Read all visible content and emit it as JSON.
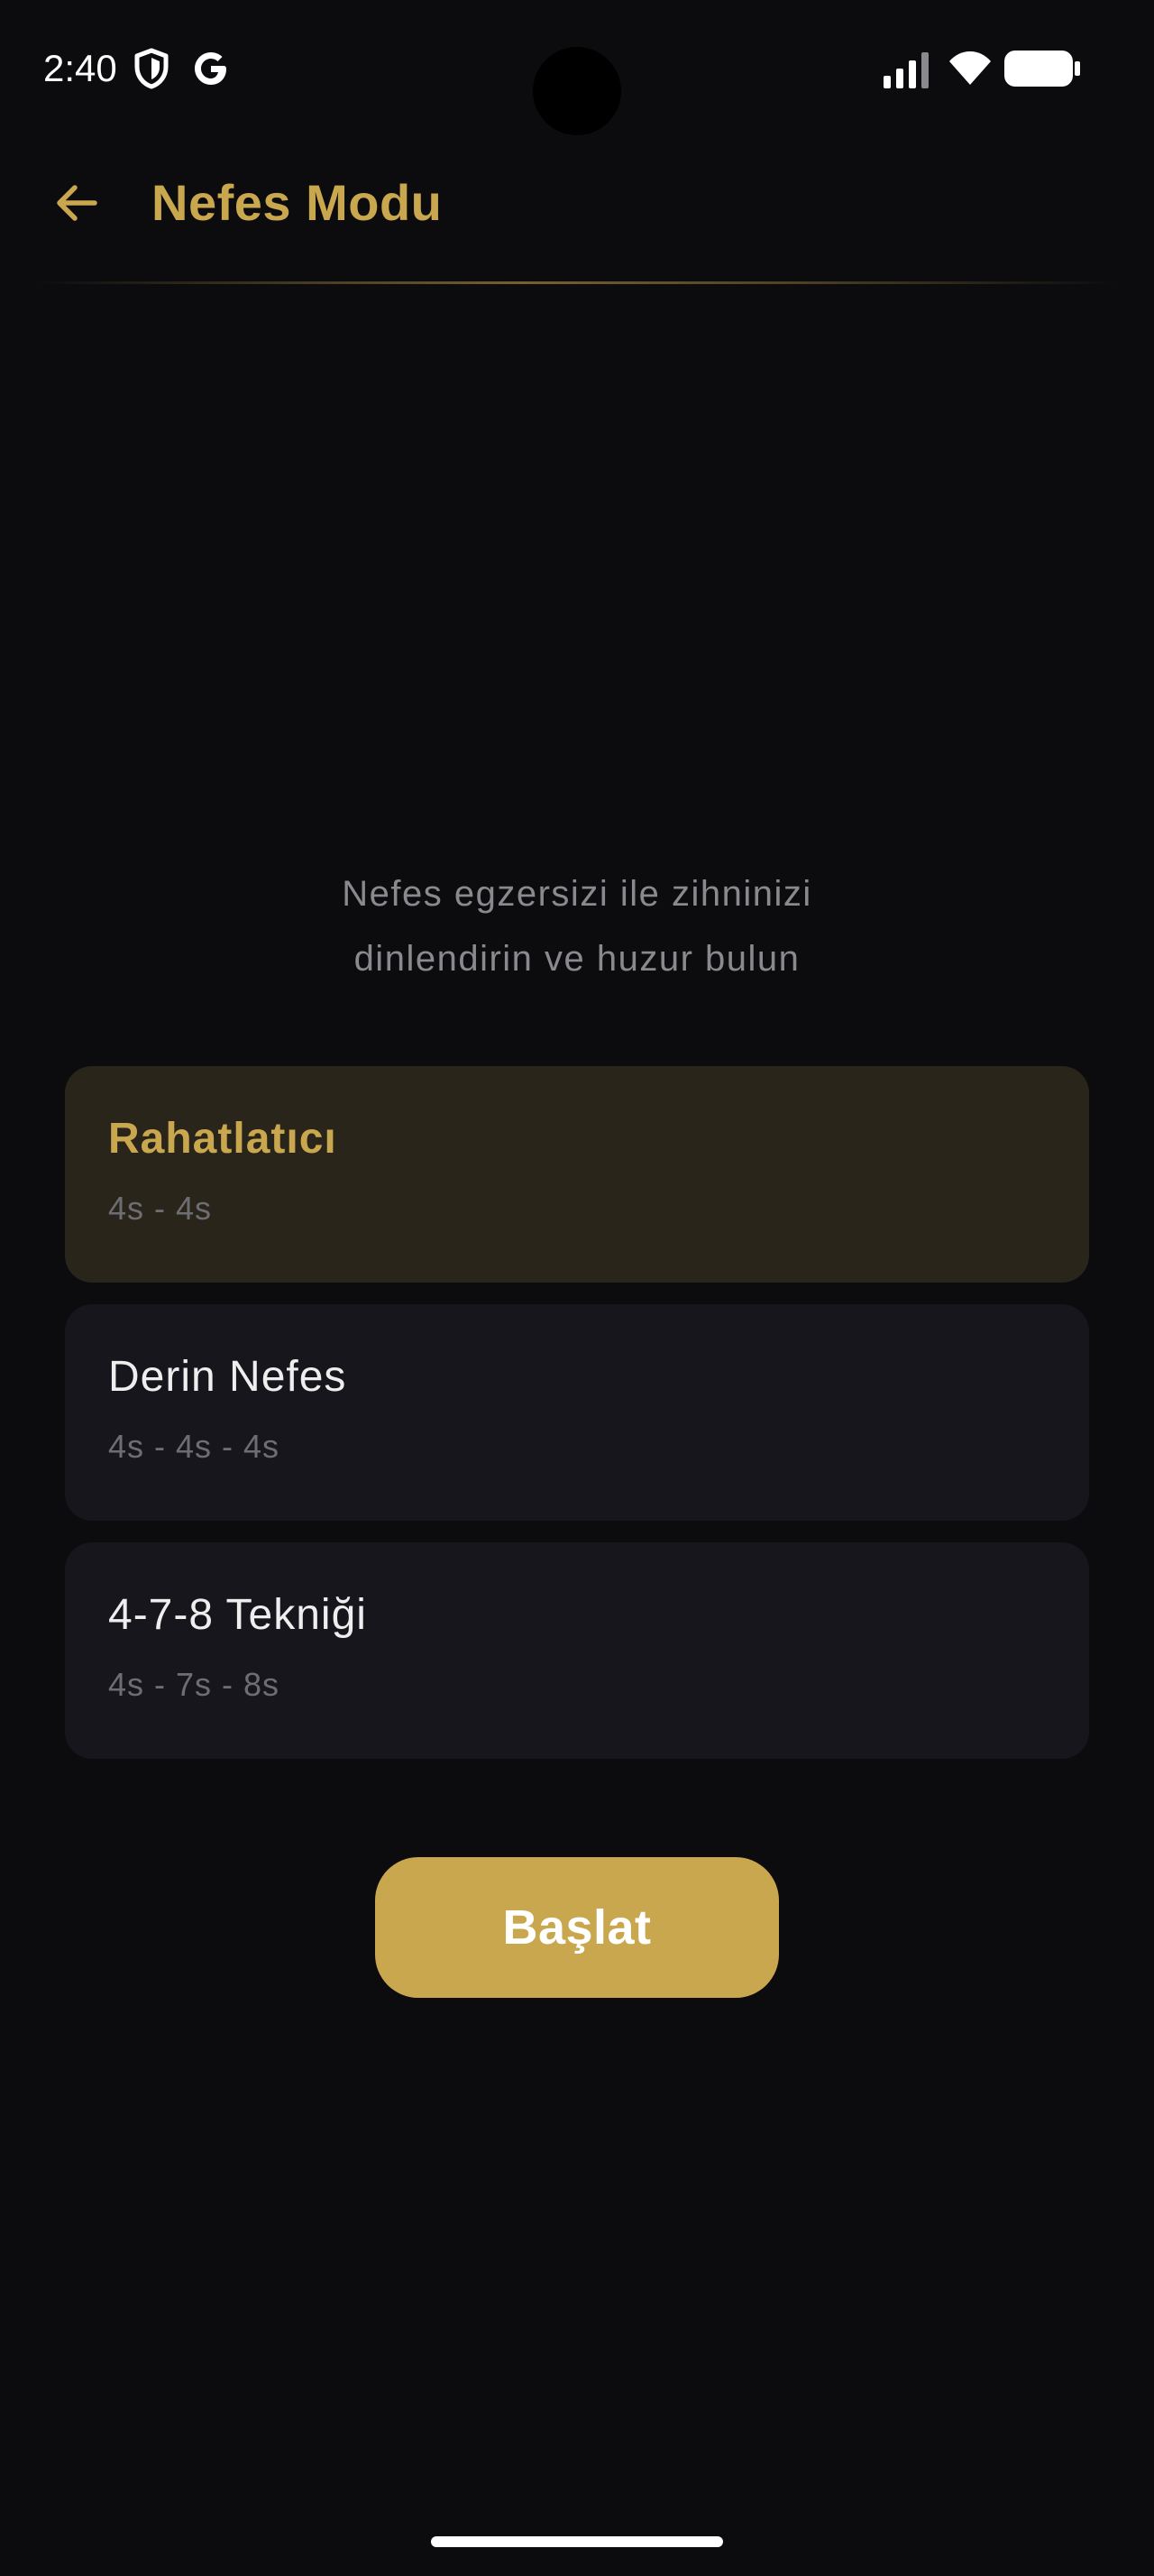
{
  "status_bar": {
    "time": "2:40",
    "icons": [
      "shield-icon",
      "google-icon",
      "signal-icon",
      "wifi-icon",
      "battery-icon"
    ]
  },
  "app_bar": {
    "title": "Nefes Modu",
    "back_icon": "arrow-left-icon",
    "accent_color": "#c9a74e"
  },
  "description": {
    "line1": "Nefes egzersizi ile zihninizi",
    "line2": "dinlendirin ve huzur bulun"
  },
  "modes": [
    {
      "name": "Rahatlatıcı",
      "timing": "4s - 4s",
      "selected": true
    },
    {
      "name": "Derin Nefes",
      "timing": "4s - 4s - 4s",
      "selected": false
    },
    {
      "name": "4-7-8 Tekniği",
      "timing": "4s - 7s - 8s",
      "selected": false
    }
  ],
  "start_button": {
    "label": "Başlat"
  },
  "colors": {
    "background": "#0c0c0f",
    "card": "#16161c",
    "card_selected": "#29251b",
    "accent": "#c9a74e",
    "muted_text": "#8a8a8e"
  }
}
